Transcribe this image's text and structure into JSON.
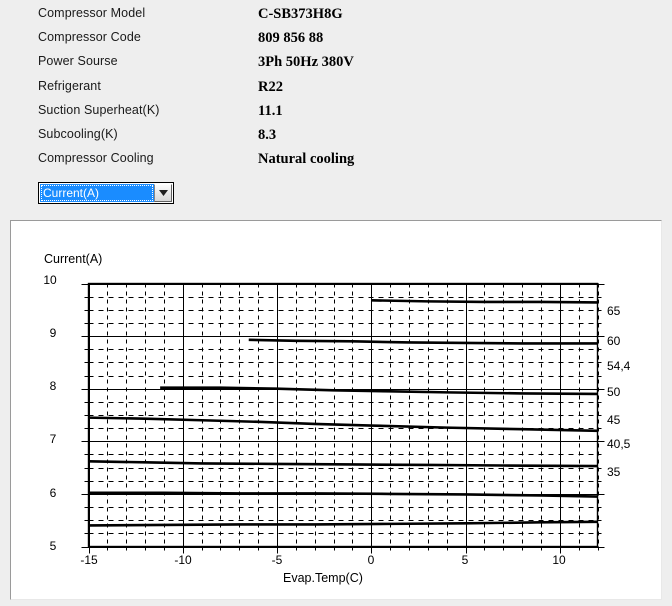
{
  "specs": {
    "rows": [
      {
        "label": "Compressor  Model",
        "value": "C-SB373H8G"
      },
      {
        "label": "Compressor Code",
        "value": "809 856 88"
      },
      {
        "label": "Power Sourse",
        "value": "3Ph  50Hz  380V"
      },
      {
        "label": "Refrigerant",
        "value": "R22"
      },
      {
        "label": "Suction Superheat(K)",
        "value": "11.1"
      },
      {
        "label": "Subcooling(K)",
        "value": "8.3"
      },
      {
        "label": "Compressor Cooling",
        "value": "Natural cooling"
      }
    ]
  },
  "chart_selector": {
    "selected": "Current(A)",
    "options": [
      "Current(A)"
    ],
    "arrow_icon": "chevron-down-icon",
    "highlight_color": "#1a8cff"
  },
  "chart_data": {
    "type": "line",
    "title": "",
    "ylabel": "Current(A)",
    "xlabel": "Evap.Temp(C)",
    "xlim": [
      -15,
      12
    ],
    "ylim": [
      5,
      10
    ],
    "xticks": [
      -15,
      -10,
      -5,
      0,
      5,
      10
    ],
    "xtick_labels": [
      "-15",
      "-10",
      "-5",
      "0",
      "5",
      "10"
    ],
    "yticks": [
      5,
      6,
      7,
      8,
      9,
      10
    ],
    "ytick_labels": [
      "5",
      "6",
      "7",
      "8",
      "9",
      "10"
    ],
    "grid": true,
    "grid_style": "solid major, dashed minor",
    "legend_position": "right",
    "legend_title": "",
    "series": [
      {
        "name": "65",
        "label": "65",
        "x": [
          0.0,
          3.0,
          6.0,
          9.0,
          12.0
        ],
        "y": [
          9.68,
          9.66,
          9.65,
          9.65,
          9.64
        ]
      },
      {
        "name": "60",
        "label": "60",
        "x": [
          -6.5,
          -4.0,
          -1.0,
          2.0,
          5.0,
          8.0,
          12.0
        ],
        "y": [
          8.93,
          8.91,
          8.9,
          8.88,
          8.87,
          8.86,
          8.86
        ]
      },
      {
        "name": "54,4",
        "label": "54,4",
        "x": [
          -11.2,
          -8.0,
          -5.0,
          -2.0,
          1.0,
          4.0,
          8.0,
          12.0
        ],
        "y": [
          8.02,
          8.02,
          8.0,
          7.97,
          7.95,
          7.93,
          7.91,
          7.9
        ]
      },
      {
        "name": "50",
        "label": "50",
        "x": [
          -15.0,
          -12.0,
          -9.0,
          -6.0,
          -3.0,
          0.0,
          4.0,
          8.0,
          12.0
        ],
        "y": [
          7.45,
          7.43,
          7.4,
          7.37,
          7.33,
          7.3,
          7.26,
          7.23,
          7.2
        ]
      },
      {
        "name": "45",
        "label": "45",
        "x": [
          -15.0,
          -12.0,
          -9.0,
          -5.0,
          -1.0,
          3.0,
          7.0,
          12.0
        ],
        "y": [
          6.62,
          6.6,
          6.58,
          6.57,
          6.56,
          6.55,
          6.54,
          6.53
        ]
      },
      {
        "name": "40,5",
        "label": "40,5",
        "x": [
          -15.0,
          -11.0,
          -7.0,
          -3.0,
          1.0,
          5.0,
          9.0,
          12.0
        ],
        "y": [
          6.02,
          6.02,
          6.01,
          6.01,
          6.0,
          5.99,
          5.97,
          5.95
        ]
      },
      {
        "name": "35",
        "label": "35",
        "x": [
          -15.0,
          -11.0,
          -7.0,
          -3.0,
          1.0,
          5.0,
          9.0,
          12.0
        ],
        "y": [
          5.4,
          5.41,
          5.42,
          5.42,
          5.43,
          5.44,
          5.46,
          5.47
        ]
      }
    ]
  }
}
